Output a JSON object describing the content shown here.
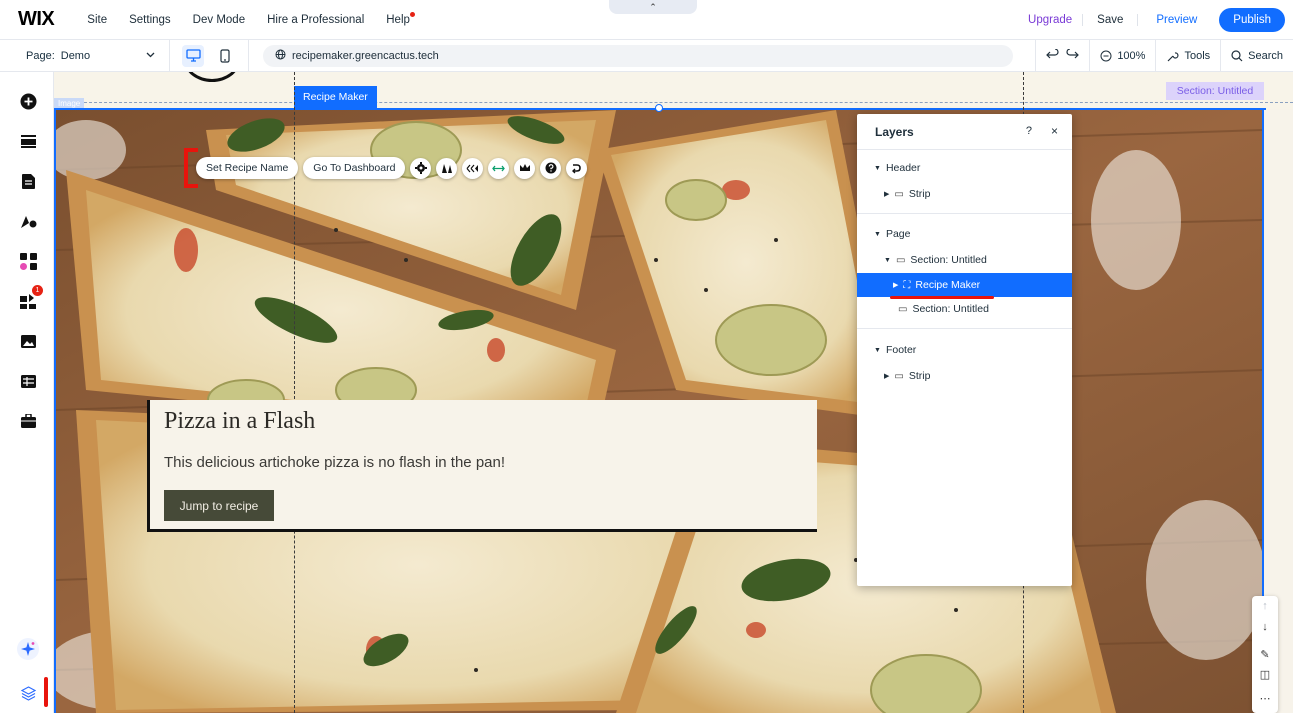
{
  "topbar": {
    "logo": "WIX",
    "menu": [
      "Site",
      "Settings",
      "Dev Mode",
      "Hire a Professional",
      "Help"
    ],
    "collapse_glyph": "⌃",
    "upgrade": "Upgrade",
    "save": "Save",
    "preview": "Preview",
    "publish": "Publish"
  },
  "subbar": {
    "page_label": "Page:",
    "page_value": "Demo",
    "url": "recipemaker.greencactus.tech",
    "zoom": "100%",
    "tools": "Tools",
    "search": "Search"
  },
  "sidebar": {
    "icons": [
      "add-icon",
      "sections-icon",
      "pages-icon",
      "design-icon",
      "apps-icon",
      "business-apps-icon",
      "media-icon",
      "cms-icon",
      "portfolio-icon",
      "ai-assistant-icon",
      "layers-icon"
    ],
    "badge": "1"
  },
  "canvas": {
    "image_tag": "Image",
    "recipe_tag": "Recipe Maker",
    "section_tag": "Section: Untitled",
    "toolbar": {
      "set_name": "Set Recipe Name",
      "dashboard": "Go To Dashboard"
    },
    "card": {
      "title": "Pizza in a Flash",
      "description": "This delicious artichoke pizza is no flash in the pan!",
      "button": "Jump to recipe"
    }
  },
  "layers": {
    "title": "Layers",
    "help": "?",
    "close": "×",
    "rows": [
      {
        "label": "Header"
      },
      {
        "label": "Strip"
      },
      {
        "label": "Page"
      },
      {
        "label": "Section: Untitled"
      },
      {
        "label": "Recipe Maker"
      },
      {
        "label": "Section: Untitled"
      },
      {
        "label": "Footer"
      },
      {
        "label": "Strip"
      }
    ]
  },
  "colors": {
    "accent": "#116dff",
    "annotation_red": "#e8140c",
    "upgrade_purple": "#7a3bd6",
    "card_button": "#464a38"
  }
}
